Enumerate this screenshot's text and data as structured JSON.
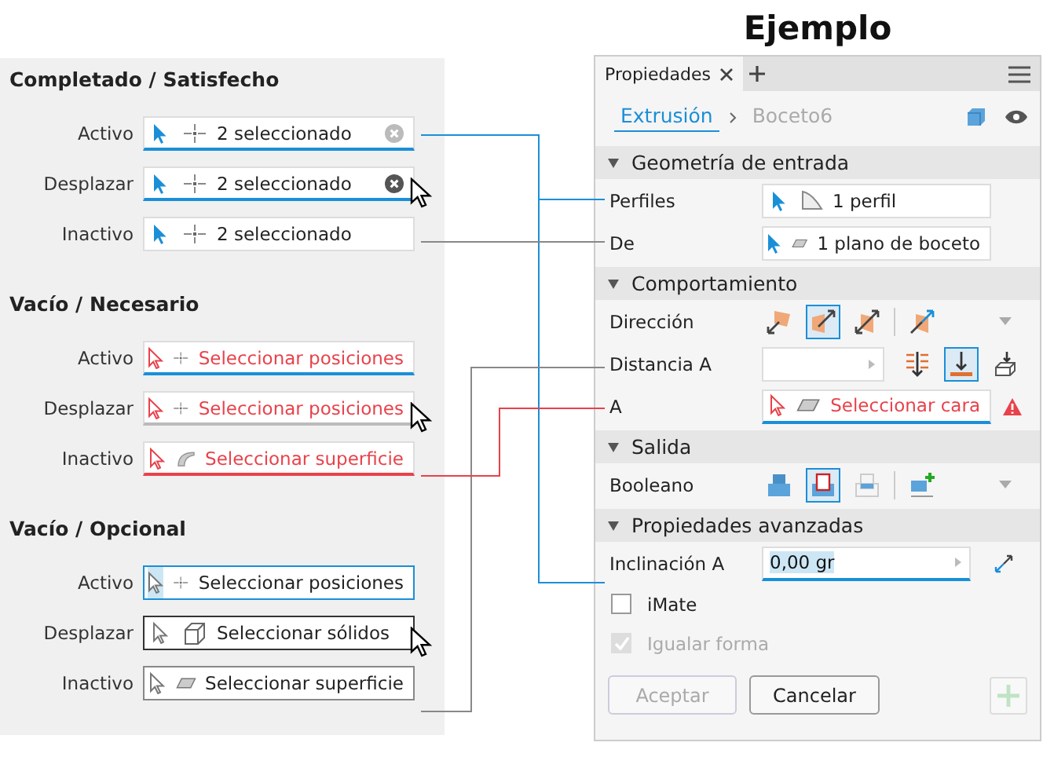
{
  "states_panel": {
    "groups": [
      {
        "title": "Completado / Satisfecho",
        "rows": [
          {
            "label": "Activo",
            "kind": "done",
            "active": true,
            "hovered": false,
            "shape": {
              "kind": "point"
            },
            "text": "2 seleccionado",
            "clear_button": true
          },
          {
            "label": "Desplazar",
            "kind": "done",
            "active": false,
            "hovered": true,
            "shape": {
              "kind": "point"
            },
            "text": "2 seleccionado",
            "clear_button": true
          },
          {
            "label": "Inactivo",
            "kind": "done",
            "active": false,
            "hovered": false,
            "shape": {
              "kind": "point"
            },
            "text": "2 seleccionado",
            "clear_button": false
          }
        ]
      },
      {
        "title": "Vacío / Necesario",
        "rows": [
          {
            "label": "Activo",
            "kind": "required",
            "active": true,
            "hovered": false,
            "shape": {
              "kind": "point"
            },
            "text": "Seleccionar posiciones",
            "clear_button": false
          },
          {
            "label": "Desplazar",
            "kind": "required",
            "active": false,
            "hovered": true,
            "shape": {
              "kind": "point"
            },
            "text": "Seleccionar posiciones",
            "clear_button": false
          },
          {
            "label": "Inactivo",
            "kind": "required",
            "active": false,
            "hovered": false,
            "shape": {
              "kind": "surface"
            },
            "text": "Seleccionar superficie",
            "clear_button": false
          }
        ]
      },
      {
        "title": "Vacío / Opcional",
        "rows": [
          {
            "label": "Activo",
            "kind": "optional",
            "active": true,
            "hovered": false,
            "shape": {
              "kind": "point"
            },
            "text": "Seleccionar posiciones",
            "clear_button": false
          },
          {
            "label": "Desplazar",
            "kind": "optional",
            "active": false,
            "hovered": true,
            "shape": {
              "kind": "solid"
            },
            "text": "Seleccionar sólidos",
            "clear_button": false
          },
          {
            "label": "Inactivo",
            "kind": "optional",
            "active": false,
            "hovered": false,
            "shape": {
              "kind": "plane"
            },
            "text": "Seleccionar superficie",
            "clear_button": false
          }
        ]
      }
    ]
  },
  "example": {
    "title": "Ejemplo",
    "tabs": [
      {
        "label": "Propiedades",
        "selected": true
      }
    ],
    "breadcrumb": [
      {
        "label": "Extrusión",
        "selected": true
      },
      {
        "label": "Boceto6",
        "selected": false
      }
    ],
    "sections": [
      {
        "title": "Geometría de entrada",
        "expanded": true,
        "rows": [
          {
            "kind": "selection",
            "label": "Perfiles",
            "field": {
              "kind": "done",
              "active": false,
              "shape": {
                "kind": "profile"
              },
              "text": "1 perfil"
            },
            "warning": false
          },
          {
            "kind": "selection",
            "label": "De",
            "field": {
              "kind": "done",
              "active": false,
              "shape": {
                "kind": "plane"
              },
              "text": "1 plano de boceto"
            },
            "warning": false
          }
        ]
      },
      {
        "title": "Comportamiento",
        "expanded": true,
        "rows": [
          {
            "kind": "buttons",
            "label": "Dirección",
            "dropdown": true,
            "buttons": [
              {
                "kind": "dir-a",
                "selected": false
              },
              {
                "kind": "dir-b",
                "selected": true
              },
              {
                "kind": "dir-c",
                "selected": false
              },
              {
                "kind": "separator"
              },
              {
                "kind": "dir-d",
                "selected": false
              }
            ]
          },
          {
            "kind": "value",
            "label": "Distancia A",
            "buttons": [
              {
                "kind": "dist-a",
                "selected": false
              },
              {
                "kind": "dist-b",
                "selected": true
              },
              {
                "kind": "dist-c",
                "selected": false
              }
            ]
          },
          {
            "kind": "selection",
            "label": "A",
            "field": {
              "kind": "required",
              "active": true,
              "shape": {
                "kind": "plane"
              },
              "text": "Seleccionar cara"
            },
            "warning": true
          }
        ]
      },
      {
        "title": "Salida",
        "expanded": true,
        "rows": [
          {
            "kind": "buttons",
            "label": "Booleano",
            "dropdown": true,
            "buttons": [
              {
                "kind": "join",
                "selected": false
              },
              {
                "kind": "cut",
                "selected": true
              },
              {
                "kind": "intersect",
                "selected": false
              },
              {
                "kind": "separator"
              },
              {
                "kind": "new-solid",
                "selected": false
              }
            ]
          }
        ]
      },
      {
        "title": "Propiedades avanzadas",
        "expanded": true,
        "rows": [
          {
            "kind": "value",
            "label": "Inclinación A",
            "value": "0,00 gr",
            "buttons": [
              {
                "kind": "taper-flip",
                "selected": false
              }
            ]
          },
          {
            "kind": "checkbox",
            "label": "iMate",
            "checked": false,
            "disabled": false
          },
          {
            "kind": "checkbox",
            "label": "Igualar forma",
            "checked": true,
            "disabled": true
          }
        ]
      }
    ],
    "footer": [
      {
        "label": "Aceptar",
        "disabled": true
      },
      {
        "label": "Cancelar",
        "disabled": false
      }
    ],
    "add_button": {
      "disabled": true
    }
  }
}
